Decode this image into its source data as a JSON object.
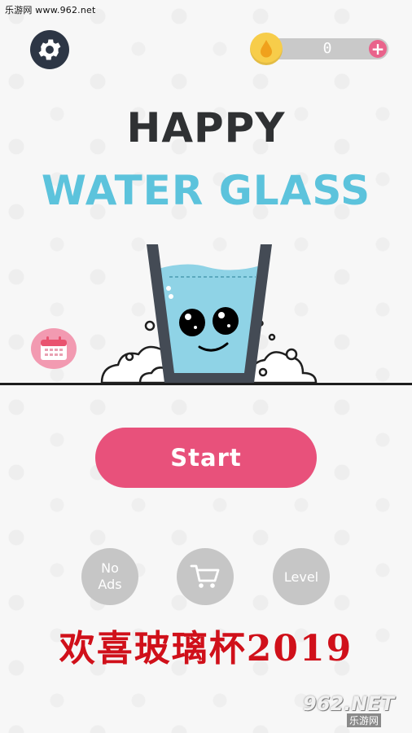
{
  "watermark_text": "乐游网 www.962.net",
  "coins": {
    "count": "0",
    "add_label": "+"
  },
  "title": {
    "line1": "HAPPY",
    "line2": "WATER GLASS"
  },
  "buttons": {
    "start": "Start",
    "no_ads": "No Ads",
    "level": "Level"
  },
  "icons": {
    "settings": "gear-icon",
    "coin": "water-drop-icon",
    "calendar": "calendar-icon",
    "shop": "shopping-cart-icon"
  },
  "promo_text": "欢喜玻璃杯2019",
  "site_badge": {
    "big": "962.NET",
    "small": "乐游网"
  },
  "colors": {
    "start_button": "#e8517b",
    "title_blue": "#5cc3dc",
    "title_dark": "#2f3133",
    "settings_bg": "#2d3645",
    "coin_yellow": "#f7cd4a",
    "plus_pink": "#e9638b",
    "round_button_grey": "#c6c6c6",
    "promo_red": "#d0101a",
    "water": "#8fd3e6"
  }
}
